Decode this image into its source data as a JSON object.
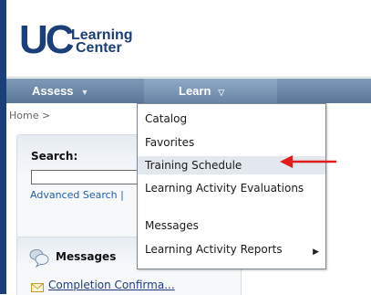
{
  "logo": {
    "uc": "UC",
    "line1": "Learning",
    "line2": "Center"
  },
  "nav": {
    "assess": {
      "label": "Assess",
      "caret": "▼"
    },
    "learn": {
      "label": "Learn",
      "caret": "▽"
    }
  },
  "breadcrumb": "Home >",
  "search": {
    "label": "Search:",
    "value": "",
    "advanced_link": "Advanced Search |"
  },
  "messages": {
    "title": "Messages",
    "items": [
      {
        "label": "Completion Confirma..."
      }
    ]
  },
  "learn_menu": {
    "items": [
      {
        "label": "Catalog"
      },
      {
        "label": "Favorites"
      },
      {
        "label": "Training Schedule",
        "highlighted": true
      },
      {
        "label": "Learning Activity Evaluations"
      },
      {
        "label": "Messages"
      },
      {
        "label": "Learning Activity Reports",
        "submenu_caret": "▶"
      }
    ]
  },
  "colors": {
    "frame": "#1b3f78",
    "nav": "#6b87a7",
    "annotation_arrow": "#e21b1b",
    "link": "#1f5fb0"
  }
}
